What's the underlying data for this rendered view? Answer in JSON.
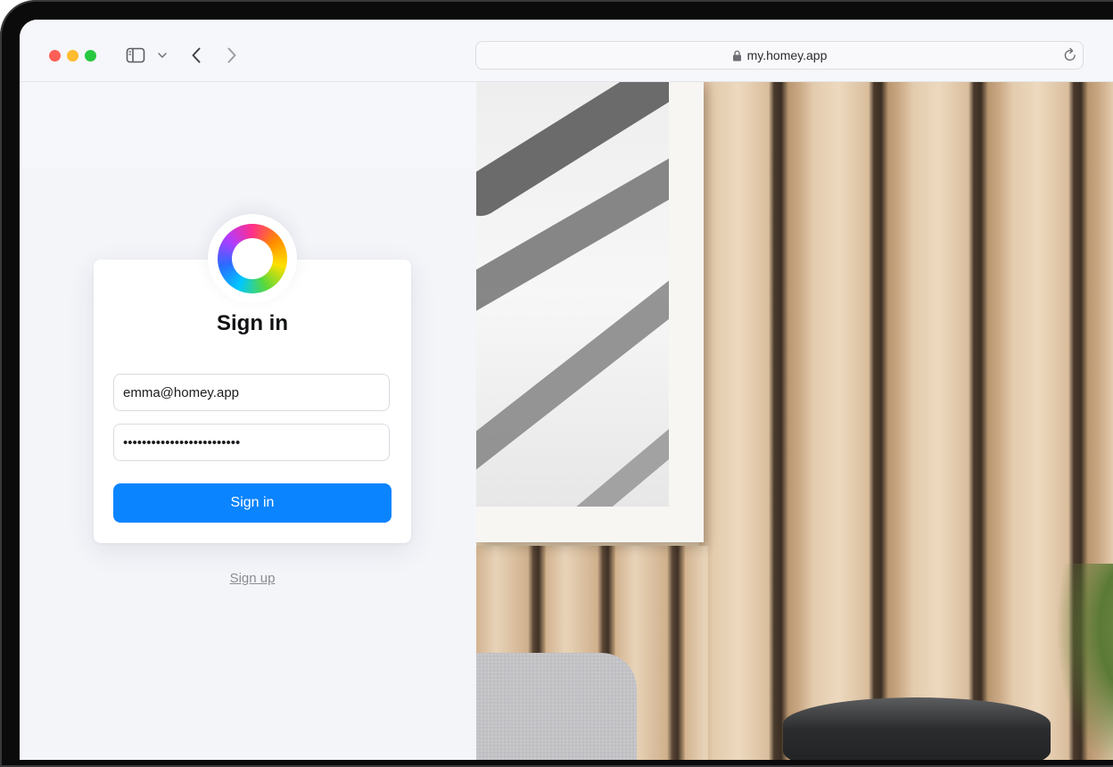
{
  "browser": {
    "url": "my.homey.app"
  },
  "signin": {
    "title": "Sign in",
    "email_value": "emma@homey.app",
    "password_value": "•••••••••••••••••••••••••",
    "button_label": "Sign in",
    "signup_link": "Sign up"
  },
  "icons": {
    "lock": "lock-icon",
    "reload": "reload-icon",
    "sidebar": "sidebar-icon",
    "back": "chevron-left-icon",
    "forward": "chevron-right-icon"
  },
  "colors": {
    "primary_button": "#0a84ff",
    "traffic_red": "#fe5f57",
    "traffic_yellow": "#febc2e",
    "traffic_green": "#28c840"
  }
}
